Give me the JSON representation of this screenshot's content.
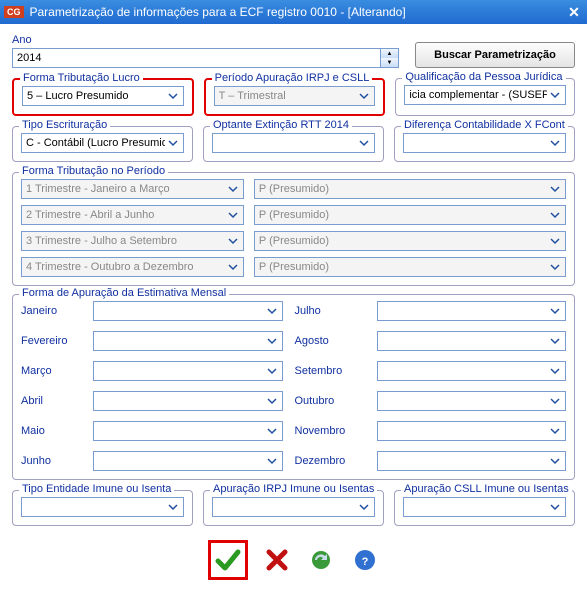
{
  "titlebar": {
    "app": "CG",
    "title": "Parametrização de informações para a ECF registro 0010 - [Alterando]"
  },
  "ano": {
    "label": "Ano",
    "value": "2014"
  },
  "btn_buscar": "Buscar Parametrização",
  "group1": {
    "forma_trib_lucro": {
      "legend": "Forma Tributação Lucro",
      "value": "5 – Lucro Presumido"
    },
    "periodo_apuracao": {
      "legend": "Período Apuração IRPJ e CSLL",
      "value": "T – Trimestral"
    },
    "qualif_pj": {
      "legend": "Qualificação da Pessoa Jurídica",
      "value": "icia complementar - (SUSEP)"
    }
  },
  "group2": {
    "tipo_escrituracao": {
      "legend": "Tipo Escrituração",
      "value": "C - Contábil (Lucro Presumid"
    },
    "optante_rtt": {
      "legend": "Optante Extinção RTT 2014",
      "value": ""
    },
    "dif_contab": {
      "legend": "Diferença Contabilidade X FCont",
      "value": ""
    }
  },
  "forma_trib_periodo": {
    "legend": "Forma Tributação no Período",
    "rows": [
      {
        "trim": "1 Trimestre - Janeiro a Março",
        "val": "P (Presumido)"
      },
      {
        "trim": "2 Trimestre - Abril a Junho",
        "val": "P (Presumido)"
      },
      {
        "trim": "3 Trimestre - Julho a Setembro",
        "val": "P (Presumido)"
      },
      {
        "trim": "4 Trimestre - Outubro a Dezembro",
        "val": "P (Presumido)"
      }
    ]
  },
  "estimativa": {
    "legend": "Forma de Apuração da Estimativa Mensal",
    "left": [
      "Janeiro",
      "Fevereiro",
      "Março",
      "Abril",
      "Maio",
      "Junho"
    ],
    "right": [
      "Julho",
      "Agosto",
      "Setembro",
      "Outubro",
      "Novembro",
      "Dezembro"
    ]
  },
  "bottom": {
    "tipo_entidade": {
      "legend": "Tipo Entidade Imune ou Isenta",
      "value": ""
    },
    "apur_irpj": {
      "legend": "Apuração IRPJ Imune ou Isentas",
      "value": ""
    },
    "apur_csll": {
      "legend": "Apuração CSLL Imune ou Isentas",
      "value": ""
    }
  }
}
